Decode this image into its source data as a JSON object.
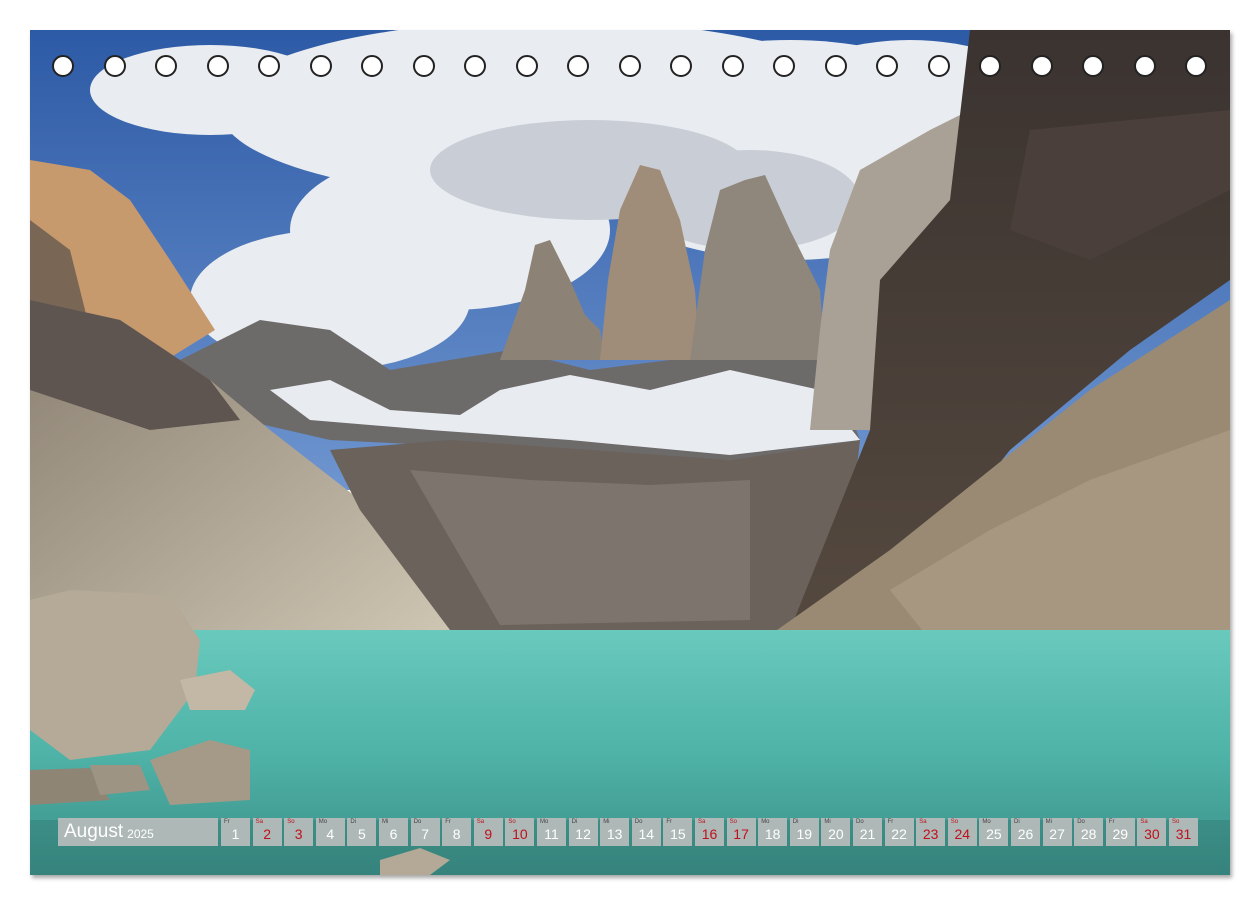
{
  "calendar": {
    "month": "August",
    "year": "2025",
    "days": [
      {
        "dow": "Fr",
        "day": "1",
        "weekend": false
      },
      {
        "dow": "Sa",
        "day": "2",
        "weekend": true
      },
      {
        "dow": "So",
        "day": "3",
        "weekend": true
      },
      {
        "dow": "Mo",
        "day": "4",
        "weekend": false
      },
      {
        "dow": "Di",
        "day": "5",
        "weekend": false
      },
      {
        "dow": "Mi",
        "day": "6",
        "weekend": false
      },
      {
        "dow": "Do",
        "day": "7",
        "weekend": false
      },
      {
        "dow": "Fr",
        "day": "8",
        "weekend": false
      },
      {
        "dow": "Sa",
        "day": "9",
        "weekend": true
      },
      {
        "dow": "So",
        "day": "10",
        "weekend": true
      },
      {
        "dow": "Mo",
        "day": "11",
        "weekend": false
      },
      {
        "dow": "Di",
        "day": "12",
        "weekend": false
      },
      {
        "dow": "Mi",
        "day": "13",
        "weekend": false
      },
      {
        "dow": "Do",
        "day": "14",
        "weekend": false
      },
      {
        "dow": "Fr",
        "day": "15",
        "weekend": false
      },
      {
        "dow": "Sa",
        "day": "16",
        "weekend": true
      },
      {
        "dow": "So",
        "day": "17",
        "weekend": true
      },
      {
        "dow": "Mo",
        "day": "18",
        "weekend": false
      },
      {
        "dow": "Di",
        "day": "19",
        "weekend": false
      },
      {
        "dow": "Mi",
        "day": "20",
        "weekend": false
      },
      {
        "dow": "Do",
        "day": "21",
        "weekend": false
      },
      {
        "dow": "Fr",
        "day": "22",
        "weekend": false
      },
      {
        "dow": "Sa",
        "day": "23",
        "weekend": true
      },
      {
        "dow": "So",
        "day": "24",
        "weekend": true
      },
      {
        "dow": "Mo",
        "day": "25",
        "weekend": false
      },
      {
        "dow": "Di",
        "day": "26",
        "weekend": false
      },
      {
        "dow": "Mi",
        "day": "27",
        "weekend": false
      },
      {
        "dow": "Do",
        "day": "28",
        "weekend": false
      },
      {
        "dow": "Fr",
        "day": "29",
        "weekend": false
      },
      {
        "dow": "Sa",
        "day": "30",
        "weekend": true
      },
      {
        "dow": "So",
        "day": "31",
        "weekend": true
      }
    ]
  },
  "colors": {
    "weekend": "#c0101c",
    "lake": "#4fb3a8",
    "sky": "#3f6fb8"
  }
}
